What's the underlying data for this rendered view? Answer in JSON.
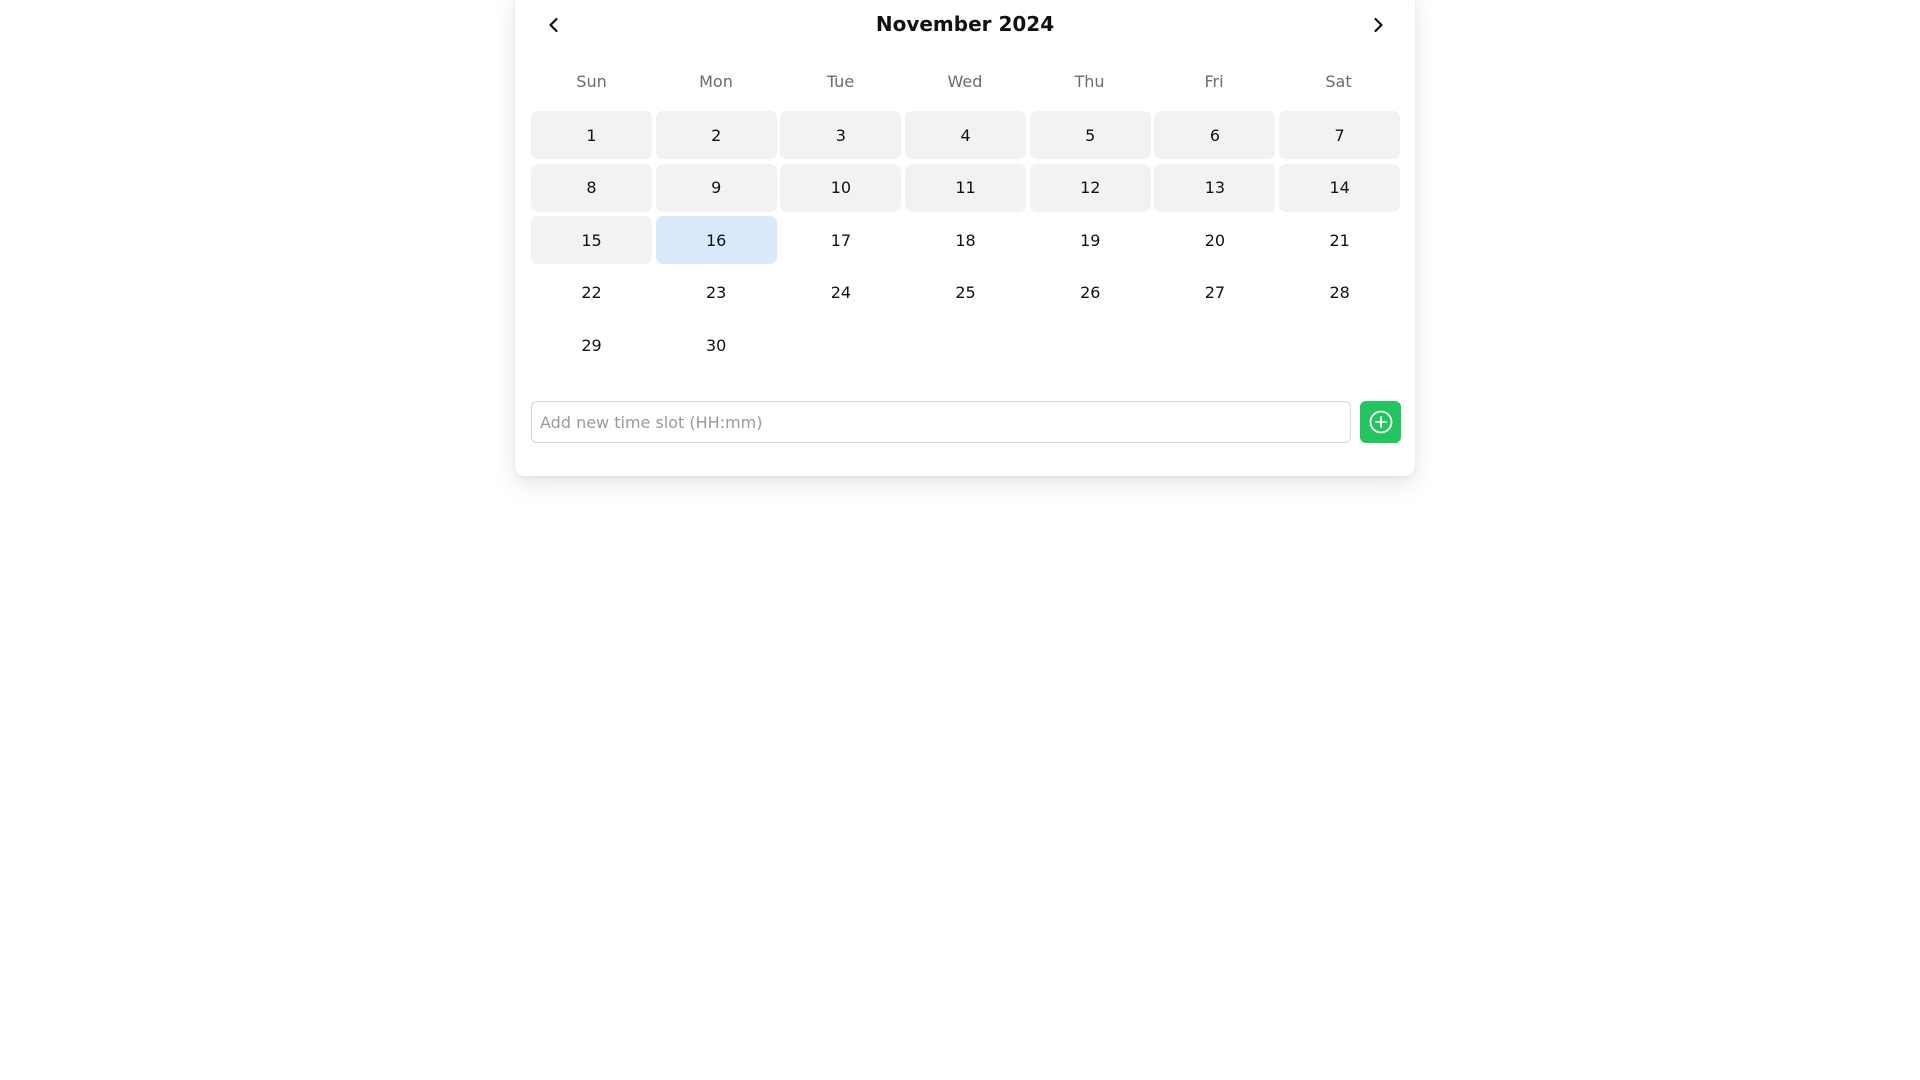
{
  "header": {
    "title": "November 2024",
    "prev_icon": "chevron-left-icon",
    "next_icon": "chevron-right-icon"
  },
  "weekdays": [
    "Sun",
    "Mon",
    "Tue",
    "Wed",
    "Thu",
    "Fri",
    "Sat"
  ],
  "days": [
    {
      "label": "1",
      "state": "past"
    },
    {
      "label": "2",
      "state": "past"
    },
    {
      "label": "3",
      "state": "past"
    },
    {
      "label": "4",
      "state": "past"
    },
    {
      "label": "5",
      "state": "past"
    },
    {
      "label": "6",
      "state": "past"
    },
    {
      "label": "7",
      "state": "past"
    },
    {
      "label": "8",
      "state": "past"
    },
    {
      "label": "9",
      "state": "past"
    },
    {
      "label": "10",
      "state": "past"
    },
    {
      "label": "11",
      "state": "past"
    },
    {
      "label": "12",
      "state": "past"
    },
    {
      "label": "13",
      "state": "past"
    },
    {
      "label": "14",
      "state": "past"
    },
    {
      "label": "15",
      "state": "past"
    },
    {
      "label": "16",
      "state": "selected"
    },
    {
      "label": "17",
      "state": "normal"
    },
    {
      "label": "18",
      "state": "normal"
    },
    {
      "label": "19",
      "state": "normal"
    },
    {
      "label": "20",
      "state": "normal"
    },
    {
      "label": "21",
      "state": "normal"
    },
    {
      "label": "22",
      "state": "normal"
    },
    {
      "label": "23",
      "state": "normal"
    },
    {
      "label": "24",
      "state": "normal"
    },
    {
      "label": "25",
      "state": "normal"
    },
    {
      "label": "26",
      "state": "normal"
    },
    {
      "label": "27",
      "state": "normal"
    },
    {
      "label": "28",
      "state": "normal"
    },
    {
      "label": "29",
      "state": "normal"
    },
    {
      "label": "30",
      "state": "normal"
    }
  ],
  "timeslot": {
    "value": "",
    "placeholder": "Add new time slot (HH:mm)",
    "add_icon": "plus-circle-icon"
  },
  "colors": {
    "past_day_bg": "#f1f2f4",
    "selected_day_bg": "#dbe9fc",
    "add_button_bg": "#22c55e"
  }
}
